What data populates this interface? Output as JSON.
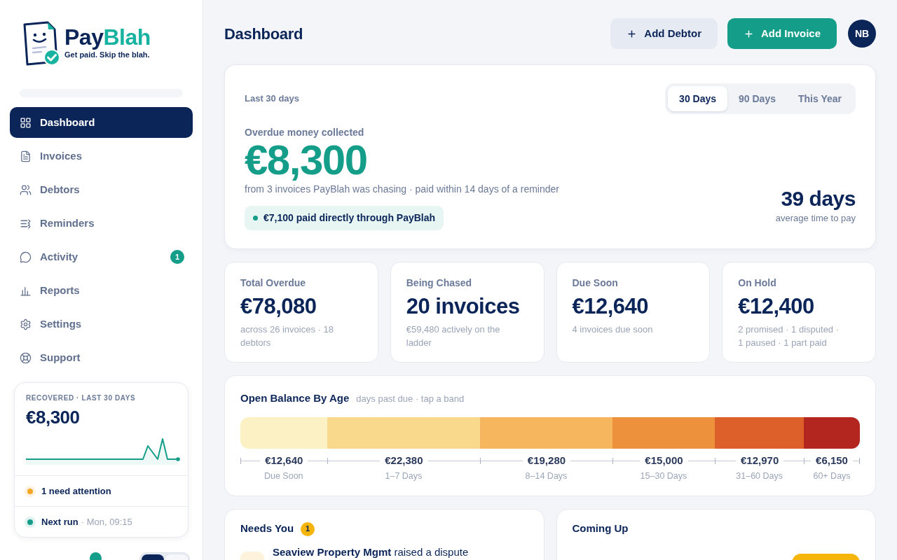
{
  "sidebar": {
    "logo": {
      "name": [
        "Pay",
        "Blah"
      ],
      "tagline": "Get paid. Skip the blah."
    },
    "nav": [
      {
        "label": "Dashboard",
        "selected": true
      },
      {
        "label": "Invoices",
        "selected": false
      },
      {
        "label": "Debtors",
        "selected": false
      },
      {
        "label": "Reminders",
        "selected": false
      },
      {
        "label": "Activity",
        "selected": false,
        "badge": "1"
      },
      {
        "label": "Reports",
        "selected": false
      },
      {
        "label": "Settings",
        "selected": false
      },
      {
        "label": "Support",
        "selected": false
      }
    ],
    "recovered_card": {
      "title": "RECOVERED · LAST 30 DAYS",
      "amount": "€8,300",
      "rows": [
        {
          "label": "1 need attention",
          "color": "#f5a623"
        },
        {
          "label": "Next run",
          "detail": "· Mon, 09:15",
          "color": "#149e8a"
        }
      ]
    },
    "mode_switch": [
      {
        "selected": true
      },
      {
        "selected": false
      }
    ]
  },
  "header": {
    "title": "Dashboard",
    "buttons": [
      {
        "label": "Add Debtor",
        "kind": "secondary"
      },
      {
        "label": "Add Invoice",
        "kind": "primary"
      }
    ],
    "avatar": "NB"
  },
  "hero": {
    "period": "Last 30 days",
    "ranges": [
      {
        "label": "30 Days",
        "selected": true
      },
      {
        "label": "90 Days",
        "selected": false
      },
      {
        "label": "This Year",
        "selected": false
      }
    ],
    "label": "Overdue money collected",
    "amount": "€8,300",
    "note": "from 3 invoices PayBlah was chasing · paid within 14 days of a reminder",
    "pill": "€7,100 paid directly through PayBlah",
    "average": "39 days",
    "average_label": "average time to pay"
  },
  "stats": [
    {
      "label": "Total Overdue",
      "value": "€78,080",
      "note": "across 26 invoices · 18 debtors"
    },
    {
      "label": "Being Chased",
      "value": "20 invoices",
      "note": "€59,480 actively on the ladder"
    },
    {
      "label": "Due Soon",
      "value": "€12,640",
      "note": "4 invoices due soon"
    },
    {
      "label": "On Hold",
      "value": "€12,400",
      "note": "2 promised · 1 disputed · 1 paused · 1 part paid"
    }
  ],
  "balance_by_age": {
    "title": "Open Balance By Age",
    "subtitle": "days past due · tap a band",
    "bands": [
      {
        "amount": "€12,640",
        "label": "Due Soon",
        "color": "#fcf0c5"
      },
      {
        "amount": "€22,380",
        "label": "1–7 Days",
        "color": "#f9d98c"
      },
      {
        "amount": "€19,280",
        "label": "8–14 Days",
        "color": "#f5b65d"
      },
      {
        "amount": "€15,000",
        "label": "15–30 Days",
        "color": "#ee913c"
      },
      {
        "amount": "€12,970",
        "label": "31–60 Days",
        "color": "#dd5f2a"
      },
      {
        "amount": "€6,150",
        "label": "60+ Days",
        "color": "#b2261f"
      }
    ]
  },
  "needs_you": {
    "title": "Needs You",
    "count": "1",
    "items": [
      {
        "text": "**Seaview Property Mgmt** raised a dispute"
      }
    ]
  },
  "coming_up": {
    "title": "Coming Up"
  }
}
